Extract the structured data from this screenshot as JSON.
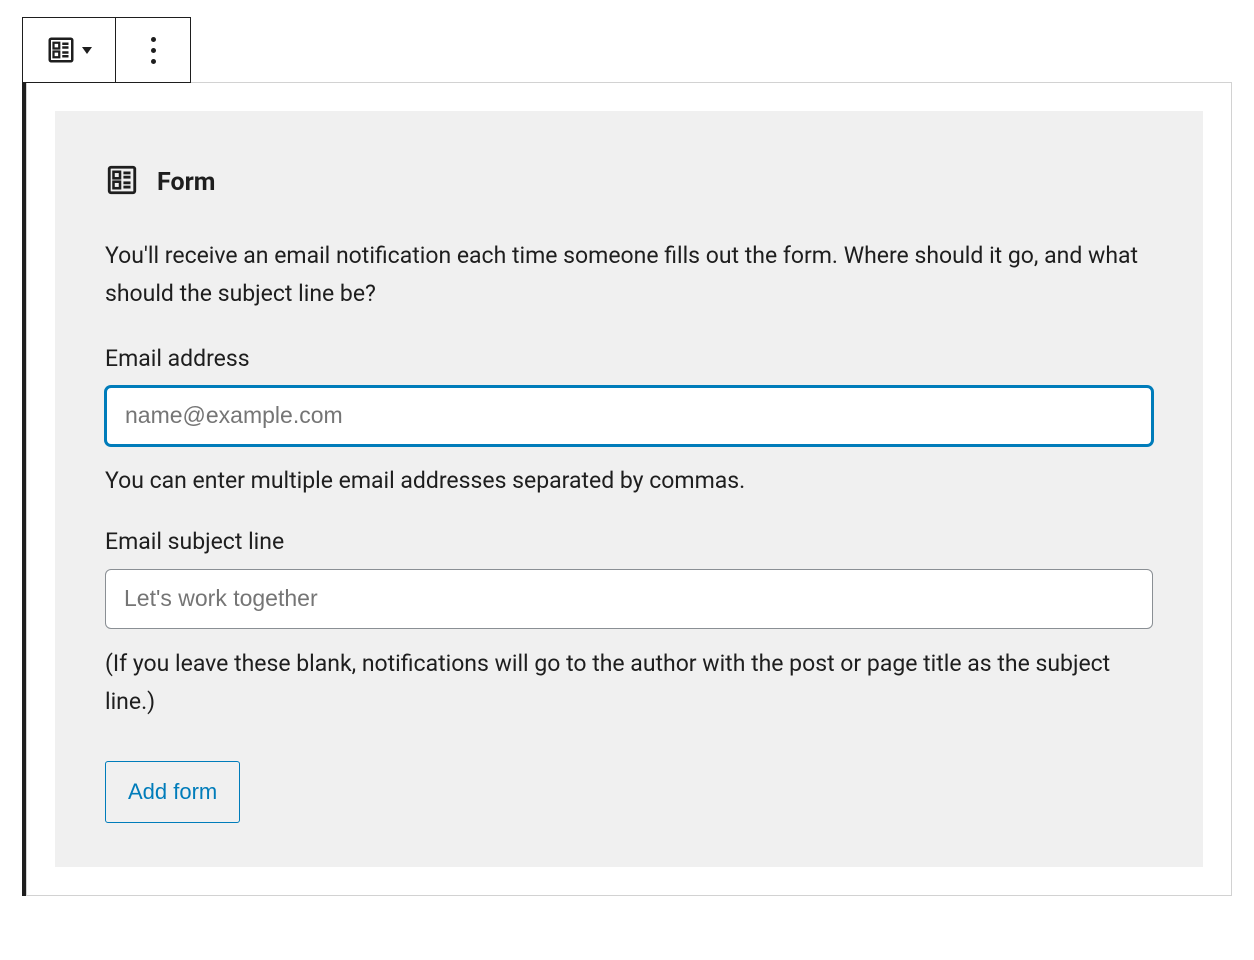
{
  "toolbar": {
    "block_type": "form-block",
    "more_menu": "more-options"
  },
  "panel": {
    "title": "Form",
    "description": "You'll receive an email notification each time someone fills out the form. Where should it go, and what should the subject line be?",
    "email": {
      "label": "Email address",
      "placeholder": "name@example.com",
      "value": "",
      "help": "You can enter multiple email addresses separated by commas."
    },
    "subject": {
      "label": "Email subject line",
      "placeholder": "Let's work together",
      "value": ""
    },
    "footer_note": "(If you leave these blank, notifications will go to the author with the post or page title as the subject line.)",
    "submit_label": "Add form"
  },
  "colors": {
    "accent": "#007cba",
    "text": "#1e1e1e",
    "panel_bg": "#f0f0f0",
    "border_gray": "#d2d2d2"
  }
}
